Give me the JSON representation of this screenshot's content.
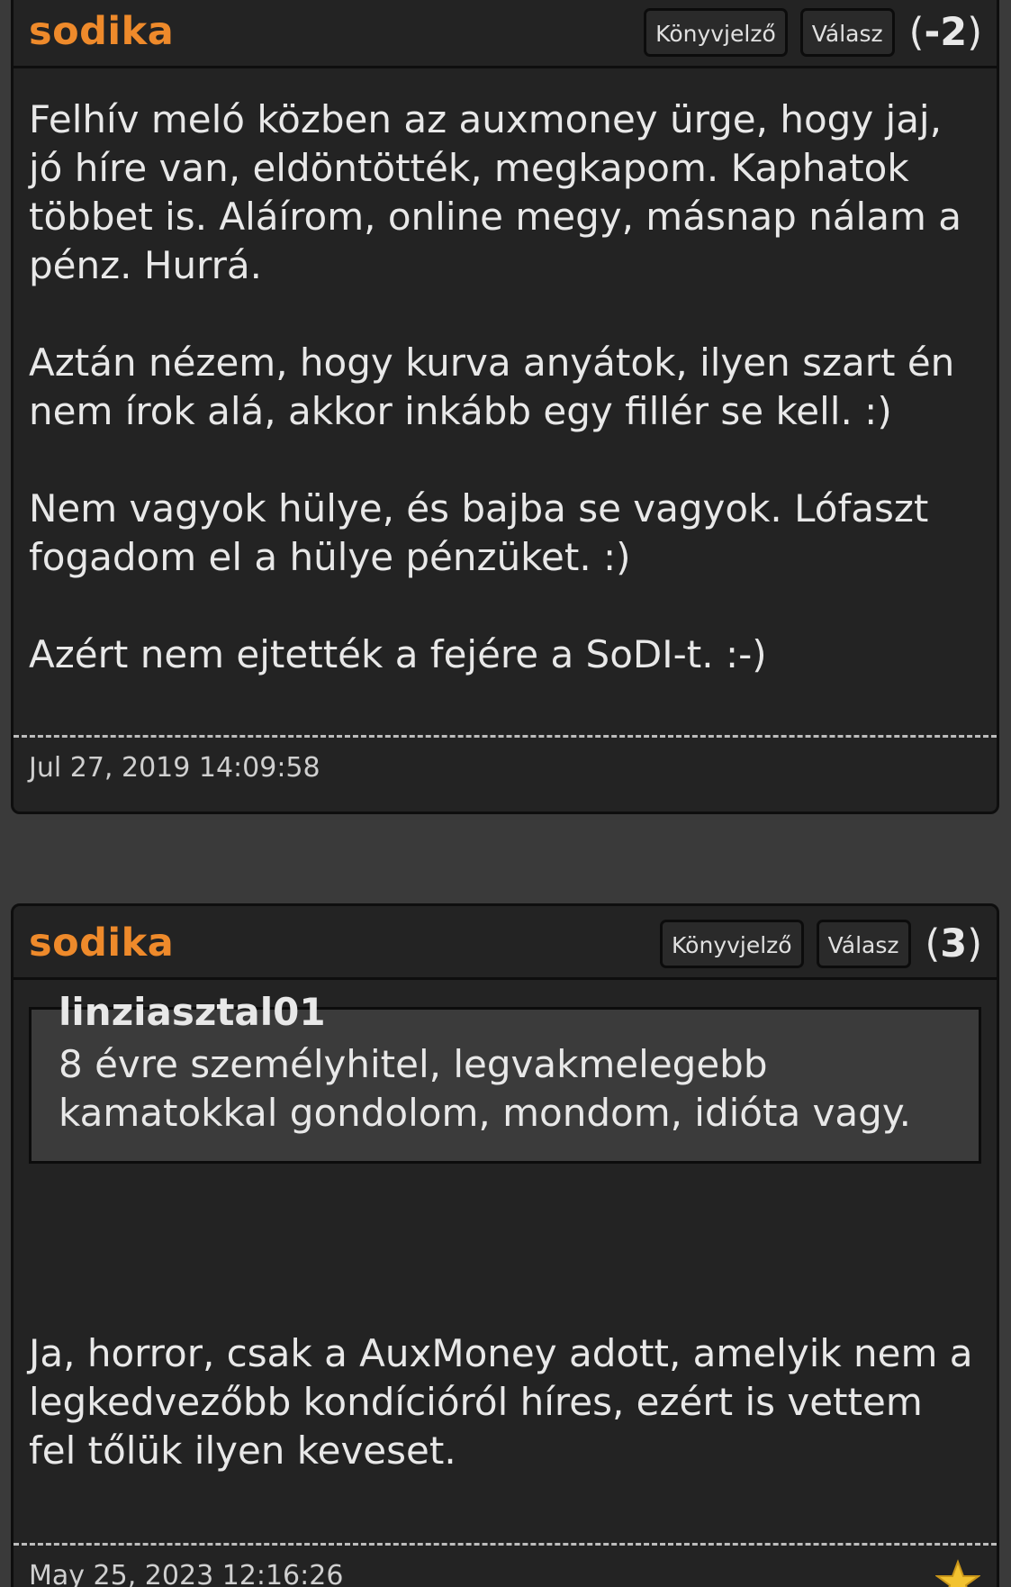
{
  "posts": [
    {
      "author": "sodika",
      "bookmark_label": "Könyvjelző",
      "reply_label": "Válasz",
      "score": "-2",
      "paragraphs": [
        "Felhív meló közben az auxmoney ürge, hogy jaj, jó híre van, eldöntötték, megkapom. Kaphatok többet is. Aláírom, online megy, másnap nálam a pénz. Hurrá.",
        "Aztán nézem, hogy kurva anyátok, ilyen szart én nem írok alá, akkor inkább egy fillér se kell. :)",
        "Nem vagyok hülye, és bajba se vagyok. Lófaszt fogadom el a hülye pénzüket. :)",
        "Azért nem ejtették a fejére a SoDI-t. :-)"
      ],
      "timestamp": "Jul 27, 2019 14:09:58"
    },
    {
      "author": "sodika",
      "bookmark_label": "Könyvjelző",
      "reply_label": "Válasz",
      "score": "3",
      "quote": {
        "author": "linziasztal01",
        "text": "8 évre személyhitel, legvakmelegebb kamatokkal gondolom, mondom, idióta vagy."
      },
      "reply": "Ja, horror, csak a AuxMoney adott, amelyik nem a legkedvezőbb kondícióról híres, ezért is vettem fel tőlük ilyen keveset.",
      "timestamp": "May 25, 2023 12:16:26",
      "star_icon": "star-icon"
    }
  ],
  "colors": {
    "author": "#ee8a2b",
    "background": "#3a3a3a",
    "post_background": "#232323",
    "quote_background": "#3b3b3b"
  }
}
